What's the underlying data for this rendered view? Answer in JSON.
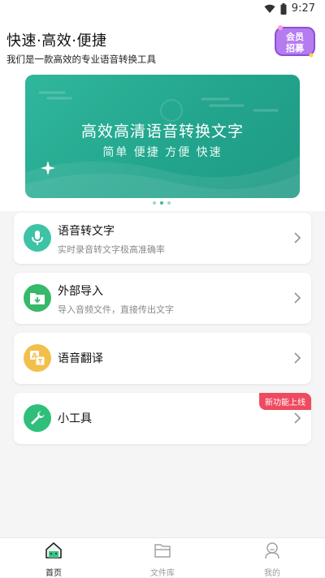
{
  "status": {
    "time": "9:27"
  },
  "header": {
    "title": "快速·高效·便捷",
    "subtitle": "我们是一款高效的专业语音转换工具",
    "vip_badge": {
      "line1": "会员",
      "line2": "招募"
    }
  },
  "banner": {
    "title": "高效高清语音转换文字",
    "subtitle": "简单 便捷 方便 快速",
    "carousel_pages": 3,
    "active_page": 2
  },
  "features": [
    {
      "title": "语音转文字",
      "desc": "实时录音转文字极高准确率",
      "icon": "microphone-icon",
      "color": "#3ec3a6"
    },
    {
      "title": "外部导入",
      "desc": "导入音频文件，直接传出文字",
      "icon": "import-folder-icon",
      "color": "#37b86b"
    },
    {
      "title": "语音翻译",
      "desc": "",
      "icon": "translate-icon",
      "color": "#f2c04a"
    },
    {
      "title": "小工具",
      "desc": "",
      "icon": "wrench-icon",
      "color": "#2fbf7b",
      "tag": "新功能上线"
    }
  ],
  "tabbar": {
    "items": [
      {
        "label": "首页",
        "icon": "home-icon",
        "active": true
      },
      {
        "label": "文件库",
        "icon": "folder-icon",
        "active": false
      },
      {
        "label": "我的",
        "icon": "profile-icon",
        "active": false
      }
    ]
  }
}
